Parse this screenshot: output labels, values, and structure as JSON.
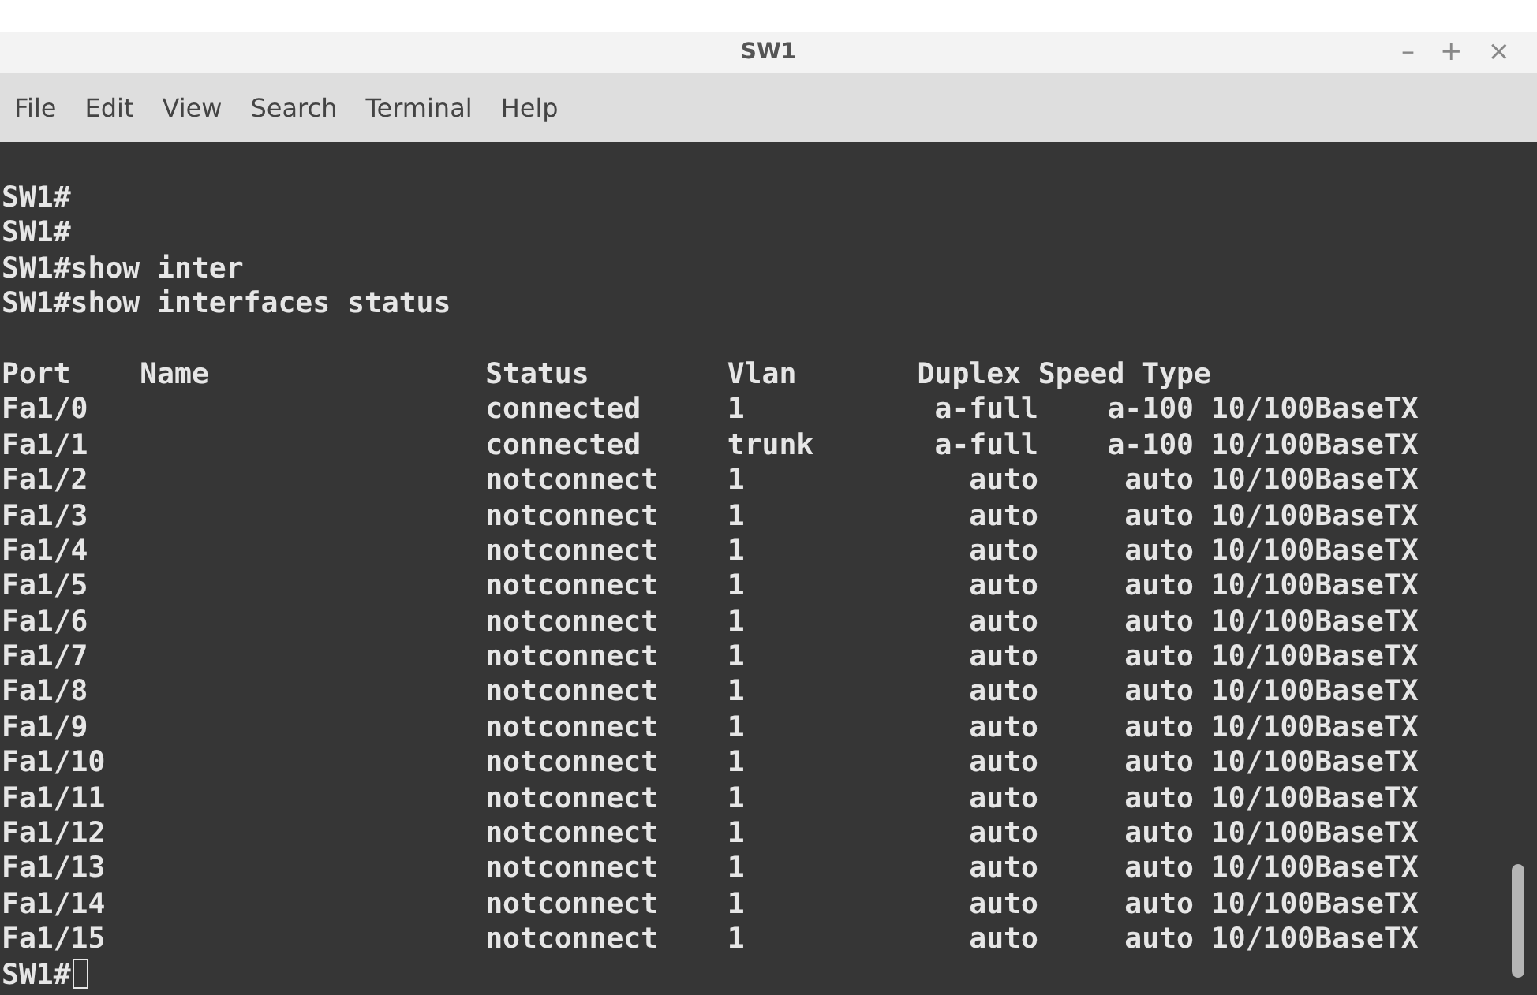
{
  "window": {
    "title": "SW1",
    "controls": [
      "–",
      "+",
      "×"
    ]
  },
  "menu": [
    "File",
    "Edit",
    "View",
    "Search",
    "Terminal",
    "Help"
  ],
  "terminal": {
    "history": [
      "SW1#",
      "SW1#",
      "SW1#show inter",
      "SW1#show interfaces status"
    ],
    "table": {
      "columns": [
        "Port",
        "Name",
        "Status",
        "Vlan",
        "Duplex",
        "Speed",
        "Type"
      ],
      "rows": [
        {
          "port": "Fa1/0",
          "status": "connected",
          "vlan": "1",
          "duplex": "a-full",
          "speed": "a-100",
          "type": "10/100BaseTX"
        },
        {
          "port": "Fa1/1",
          "status": "connected",
          "vlan": "trunk",
          "duplex": "a-full",
          "speed": "a-100",
          "type": "10/100BaseTX"
        },
        {
          "port": "Fa1/2",
          "status": "notconnect",
          "vlan": "1",
          "duplex": "auto",
          "speed": "auto",
          "type": "10/100BaseTX"
        },
        {
          "port": "Fa1/3",
          "status": "notconnect",
          "vlan": "1",
          "duplex": "auto",
          "speed": "auto",
          "type": "10/100BaseTX"
        },
        {
          "port": "Fa1/4",
          "status": "notconnect",
          "vlan": "1",
          "duplex": "auto",
          "speed": "auto",
          "type": "10/100BaseTX"
        },
        {
          "port": "Fa1/5",
          "status": "notconnect",
          "vlan": "1",
          "duplex": "auto",
          "speed": "auto",
          "type": "10/100BaseTX"
        },
        {
          "port": "Fa1/6",
          "status": "notconnect",
          "vlan": "1",
          "duplex": "auto",
          "speed": "auto",
          "type": "10/100BaseTX"
        },
        {
          "port": "Fa1/7",
          "status": "notconnect",
          "vlan": "1",
          "duplex": "auto",
          "speed": "auto",
          "type": "10/100BaseTX"
        },
        {
          "port": "Fa1/8",
          "status": "notconnect",
          "vlan": "1",
          "duplex": "auto",
          "speed": "auto",
          "type": "10/100BaseTX"
        },
        {
          "port": "Fa1/9",
          "status": "notconnect",
          "vlan": "1",
          "duplex": "auto",
          "speed": "auto",
          "type": "10/100BaseTX"
        },
        {
          "port": "Fa1/10",
          "status": "notconnect",
          "vlan": "1",
          "duplex": "auto",
          "speed": "auto",
          "type": "10/100BaseTX"
        },
        {
          "port": "Fa1/11",
          "status": "notconnect",
          "vlan": "1",
          "duplex": "auto",
          "speed": "auto",
          "type": "10/100BaseTX"
        },
        {
          "port": "Fa1/12",
          "status": "notconnect",
          "vlan": "1",
          "duplex": "auto",
          "speed": "auto",
          "type": "10/100BaseTX"
        },
        {
          "port": "Fa1/13",
          "status": "notconnect",
          "vlan": "1",
          "duplex": "auto",
          "speed": "auto",
          "type": "10/100BaseTX"
        },
        {
          "port": "Fa1/14",
          "status": "notconnect",
          "vlan": "1",
          "duplex": "auto",
          "speed": "auto",
          "type": "10/100BaseTX"
        },
        {
          "port": "Fa1/15",
          "status": "notconnect",
          "vlan": "1",
          "duplex": "auto",
          "speed": "auto",
          "type": "10/100BaseTX"
        }
      ]
    },
    "prompt": "SW1#"
  }
}
